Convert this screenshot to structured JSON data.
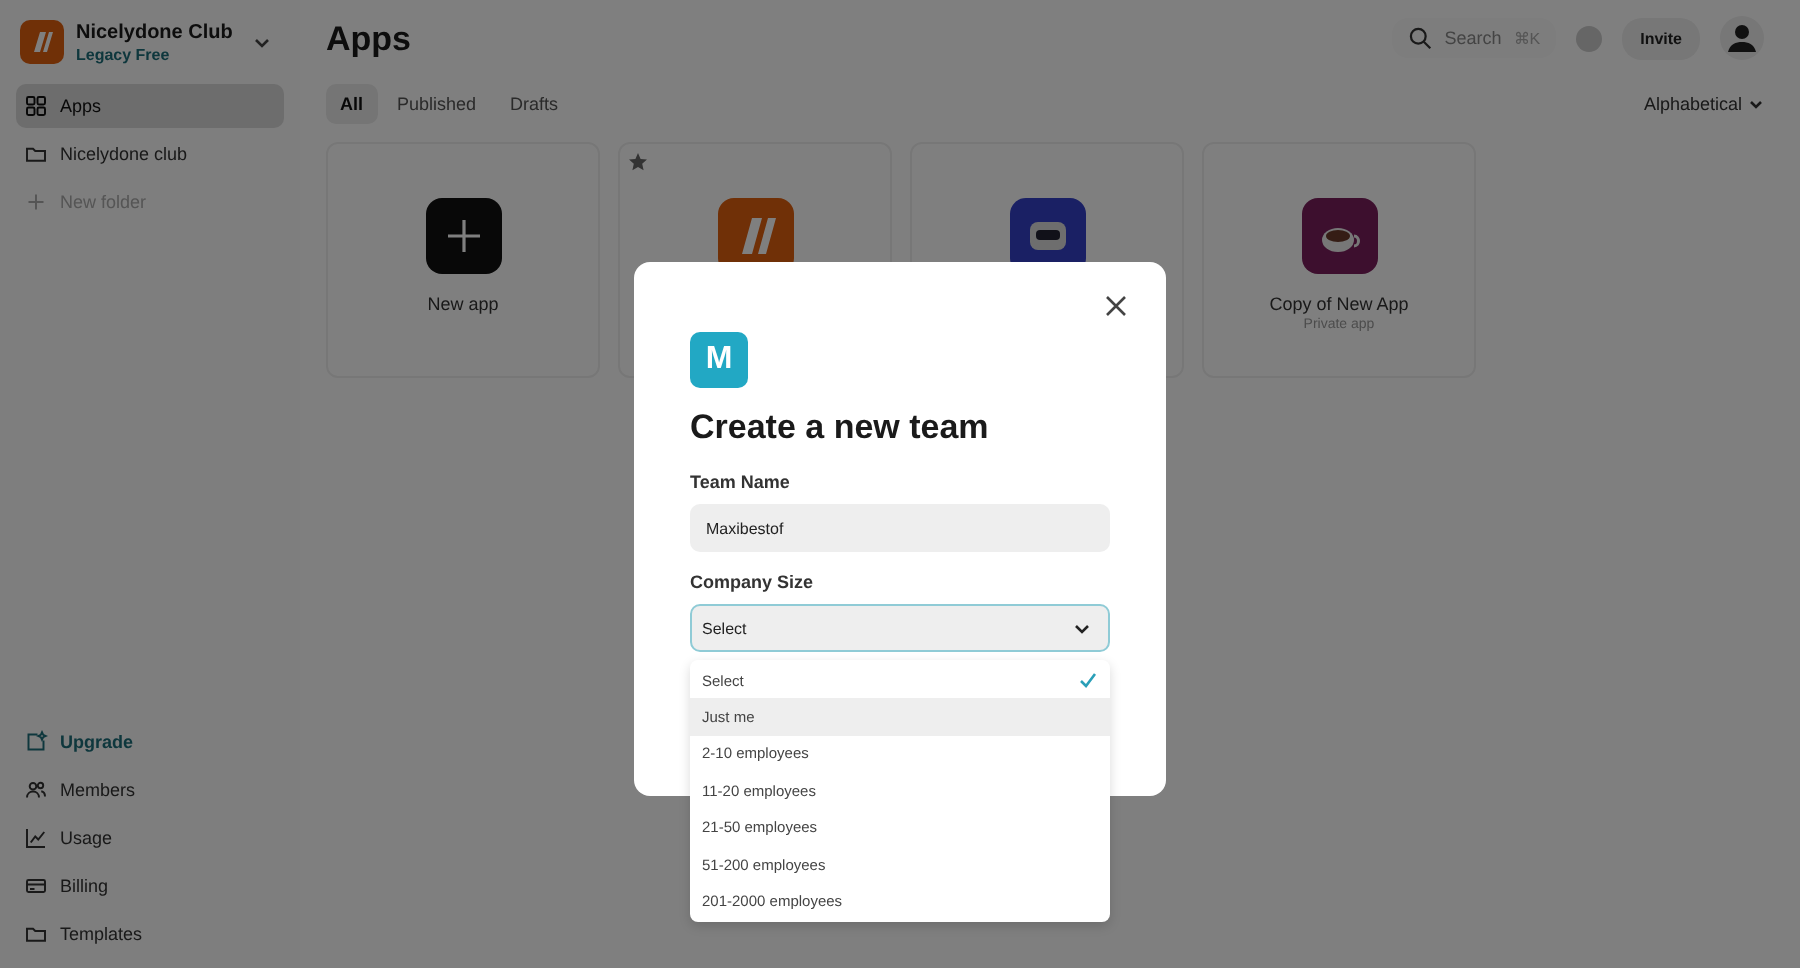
{
  "workspace": {
    "name": "Nicelydone Club",
    "plan": "Legacy Free"
  },
  "sidebar": {
    "items": [
      {
        "label": "Apps",
        "selected": true
      },
      {
        "label": "Nicelydone club",
        "selected": false
      },
      {
        "label": "New folder",
        "selected": false,
        "kind": "action"
      }
    ],
    "bottom_items": [
      {
        "label": "Upgrade",
        "highlighted": true
      },
      {
        "label": "Members",
        "highlighted": false
      },
      {
        "label": "Usage",
        "highlighted": false
      },
      {
        "label": "Billing",
        "highlighted": false
      },
      {
        "label": "Templates",
        "highlighted": false
      }
    ]
  },
  "header": {
    "title": "Apps",
    "search": {
      "placeholder": "Search",
      "shortcut": "⌘K"
    },
    "invite": "Invite"
  },
  "tabs": [
    {
      "label": "All",
      "selected": true
    },
    {
      "label": "Published",
      "selected": false
    },
    {
      "label": "Drafts",
      "selected": false
    }
  ],
  "sort": "Alphabetical",
  "apps": [
    {
      "kind": "new",
      "name": "New app",
      "starred": false
    },
    {
      "kind": "logo",
      "starred": true
    },
    {
      "kind": "robot",
      "starred": false
    },
    {
      "kind": "cup",
      "name": "Copy of New App",
      "subtitle": "Private app",
      "starred": false
    }
  ],
  "modal": {
    "badge": "M",
    "title": "Create a new team",
    "team_name": {
      "label": "Team Name",
      "value": "Maxibestof"
    },
    "company_size": {
      "label": "Company Size",
      "value": "Select",
      "options": [
        {
          "label": "Select",
          "selected": true,
          "highlighted": false
        },
        {
          "label": "Just me",
          "selected": false,
          "highlighted": true
        },
        {
          "label": "2-10 employees",
          "selected": false,
          "highlighted": false
        },
        {
          "label": "11-20 employees",
          "selected": false,
          "highlighted": false
        },
        {
          "label": "21-50 employees",
          "selected": false,
          "highlighted": false
        },
        {
          "label": "51-200 employees",
          "selected": false,
          "highlighted": false
        },
        {
          "label": "201-2000 employees",
          "selected": false,
          "highlighted": false
        }
      ]
    }
  }
}
